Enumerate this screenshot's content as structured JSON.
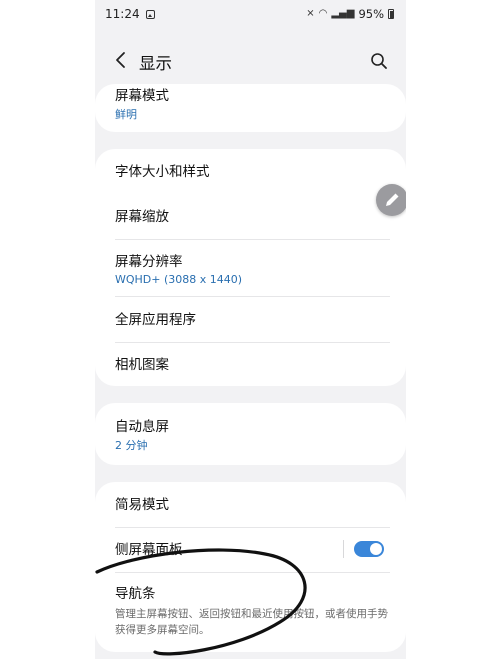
{
  "status_bar": {
    "time": "11:24",
    "battery": "95%"
  },
  "header": {
    "title": "显示"
  },
  "cards": {
    "screen_mode": {
      "title": "屏幕模式",
      "value": "鲜明"
    },
    "font_group": {
      "font_size_style": "字体大小和样式",
      "screen_zoom": "屏幕缩放",
      "screen_resolution": "屏幕分辨率",
      "screen_resolution_value": "WQHD+ (3088 x 1440)",
      "full_screen_apps": "全屏应用程序",
      "camera_cutout": "相机图案"
    },
    "screen_timeout": {
      "title": "自动息屏",
      "value": "2 分钟"
    },
    "bottom_group": {
      "easy_mode": "简易模式",
      "edge_panels": "侧屏幕面板",
      "edge_panels_enabled": true,
      "navigation_bar": "导航条",
      "navigation_bar_desc": "管理主屏幕按钮、返回按钮和最近使用按钮，或者使用手势获得更多屏幕空间。"
    }
  },
  "colors": {
    "accent": "#3a86d9",
    "link_text": "#2a6fb0",
    "background": "#f2f2f4",
    "card": "#ffffff"
  },
  "icons": {
    "back": "chevron-left-icon",
    "search": "search-icon",
    "edit": "pencil-icon"
  }
}
